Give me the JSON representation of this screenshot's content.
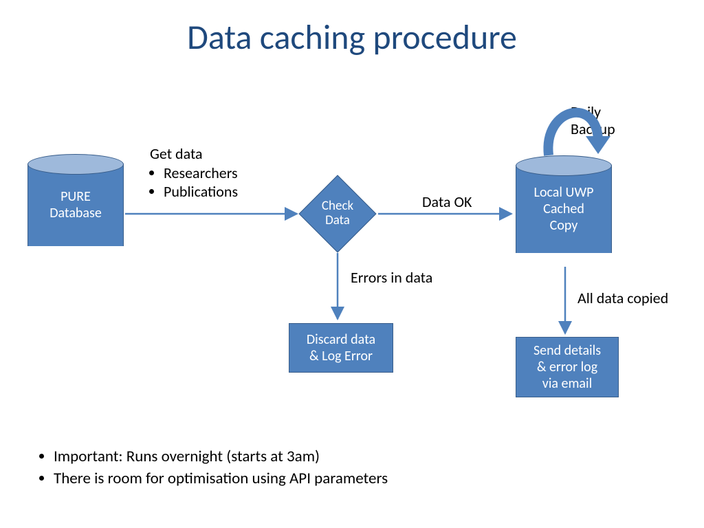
{
  "title": "Data caching procedure",
  "nodes": {
    "pure": "PURE\nDatabase",
    "check": "Check\nData",
    "local": "Local UWP\nCached\nCopy",
    "discard": "Discard data\n& Log Error",
    "send": "Send details\n& error log\nvia email"
  },
  "labels": {
    "getdata_title": "Get data",
    "getdata_items": [
      "Researchers",
      "Publications"
    ],
    "dataok": "Data OK",
    "errors": "Errors in data",
    "alldata": "All data copied",
    "backup": "Daily\nBackup"
  },
  "notes": [
    "Important: Runs overnight (starts at 3am)",
    "There is room for optimisation using API parameters"
  ],
  "colors": {
    "accent": "#4F81BD",
    "accent_dark": "#385D8A",
    "title": "#1F497D"
  }
}
